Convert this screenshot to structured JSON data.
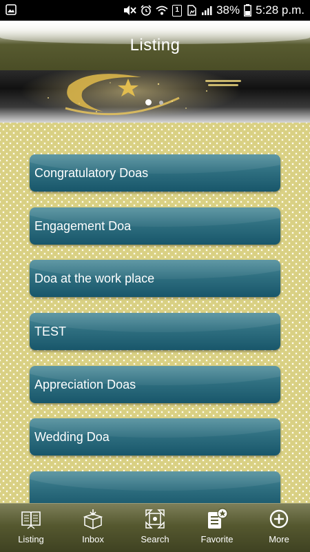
{
  "status_bar": {
    "battery": "38%",
    "time": "5:28 p.m.",
    "sim": "1"
  },
  "header": {
    "title": "Listing"
  },
  "banner": {
    "slides": 2,
    "active": 0
  },
  "list": {
    "items": [
      {
        "label": "Congratulatory Doas"
      },
      {
        "label": "Engagement Doa"
      },
      {
        "label": "Doa at the work place"
      },
      {
        "label": "TEST"
      },
      {
        "label": "Appreciation Doas"
      },
      {
        "label": "Wedding Doa"
      },
      {
        "label": ""
      }
    ]
  },
  "tabbar": {
    "tabs": [
      {
        "label": "Listing",
        "icon": "book-icon"
      },
      {
        "label": "Inbox",
        "icon": "box-icon"
      },
      {
        "label": "Search",
        "icon": "search-icon"
      },
      {
        "label": "Favorite",
        "icon": "favorite-icon"
      },
      {
        "label": "More",
        "icon": "plus-circle-icon"
      }
    ]
  }
}
